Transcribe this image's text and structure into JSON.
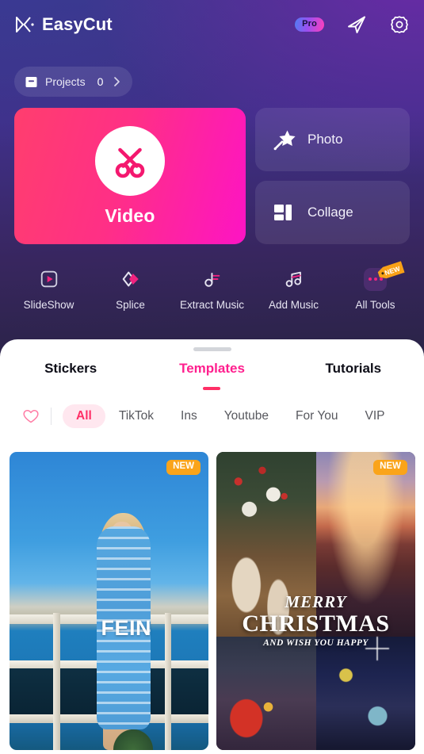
{
  "header": {
    "brand_name": "EasyCut",
    "logo_icon": "easycut-logo-icon",
    "pro_label": "Pro",
    "share_icon": "send-paper-plane-icon",
    "settings_icon": "gear-icon"
  },
  "projects": {
    "icon": "archive-box-icon",
    "label": "Projects",
    "count": "0",
    "chevron_icon": "chevron-right-icon"
  },
  "cards": {
    "video": {
      "label": "Video",
      "icon": "scissors-icon"
    },
    "photo": {
      "label": "Photo",
      "icon": "magic-wand-star-icon"
    },
    "collage": {
      "label": "Collage",
      "icon": "collage-grid-icon"
    }
  },
  "tools": [
    {
      "label": "SlideShow",
      "icon": "play-frame-icon"
    },
    {
      "label": "Splice",
      "icon": "double-diamond-icon"
    },
    {
      "label": "Extract Music",
      "icon": "music-note-extract-icon"
    },
    {
      "label": "Add Music",
      "icon": "beamed-music-note-icon"
    },
    {
      "label": "All Tools",
      "icon": "ellipsis-icon",
      "badge": "NEW"
    }
  ],
  "sheet": {
    "tabs": [
      {
        "label": "Stickers",
        "active": false
      },
      {
        "label": "Templates",
        "active": true
      },
      {
        "label": "Tutorials",
        "active": false
      }
    ],
    "favorite_icon": "heart-outline-icon",
    "filters": [
      {
        "label": "All",
        "active": true
      },
      {
        "label": "TikTok",
        "active": false
      },
      {
        "label": "Ins",
        "active": false
      },
      {
        "label": "Youtube",
        "active": false
      },
      {
        "label": "For You",
        "active": false
      },
      {
        "label": "VIP",
        "active": false
      }
    ]
  },
  "templates": [
    {
      "name": "beach-fein-template",
      "badge": "NEW",
      "overlay_text": "FEIN"
    },
    {
      "name": "merry-christmas-template",
      "badge": "NEW",
      "line1": "MERRY",
      "line2": "CHRISTMAS",
      "line3": "AND WISH YOU HAPPY"
    }
  ],
  "colors": {
    "accent_pink": "#ff1f8e",
    "accent_rose": "#ff2f66",
    "badge_orange": "#faa41a",
    "sheet_bg": "#ffffff"
  }
}
